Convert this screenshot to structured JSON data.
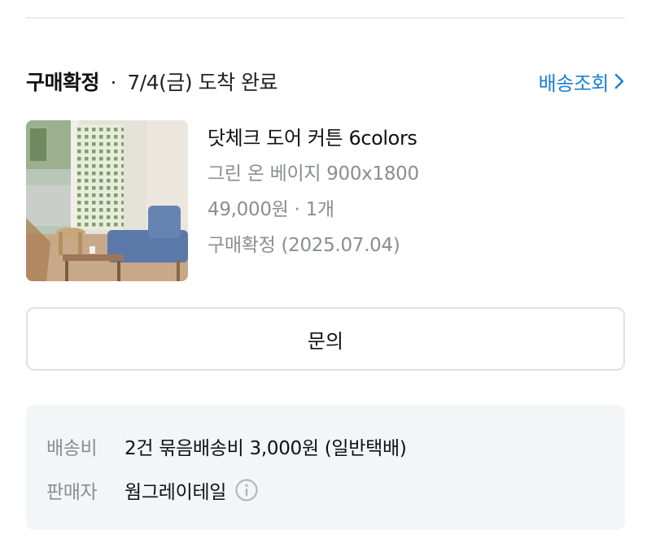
{
  "order": {
    "status": "구매확정",
    "separator": "·",
    "arrival": "7/4(금) 도착 완료",
    "tracking_link": "배송조회"
  },
  "product": {
    "name": "닷체크 도어 커튼 6colors",
    "option": "그린 온 베이지 900x1800",
    "price_qty": "49,000원 · 1개",
    "confirmation": "구매확정 (2025.07.04)"
  },
  "actions": {
    "inquiry_label": "문의"
  },
  "shipping": {
    "fee_label": "배송비",
    "fee_value": "2건 묶음배송비 3,000원 (일반택배)",
    "seller_label": "판매자",
    "seller_value": "웜그레이테일"
  },
  "colors": {
    "link": "#1a7fd4",
    "muted": "#8a8d91",
    "box_bg": "#f4f5f7"
  },
  "icons": {
    "tracking": "chevron-right-icon",
    "seller_info": "info-circle-icon"
  }
}
